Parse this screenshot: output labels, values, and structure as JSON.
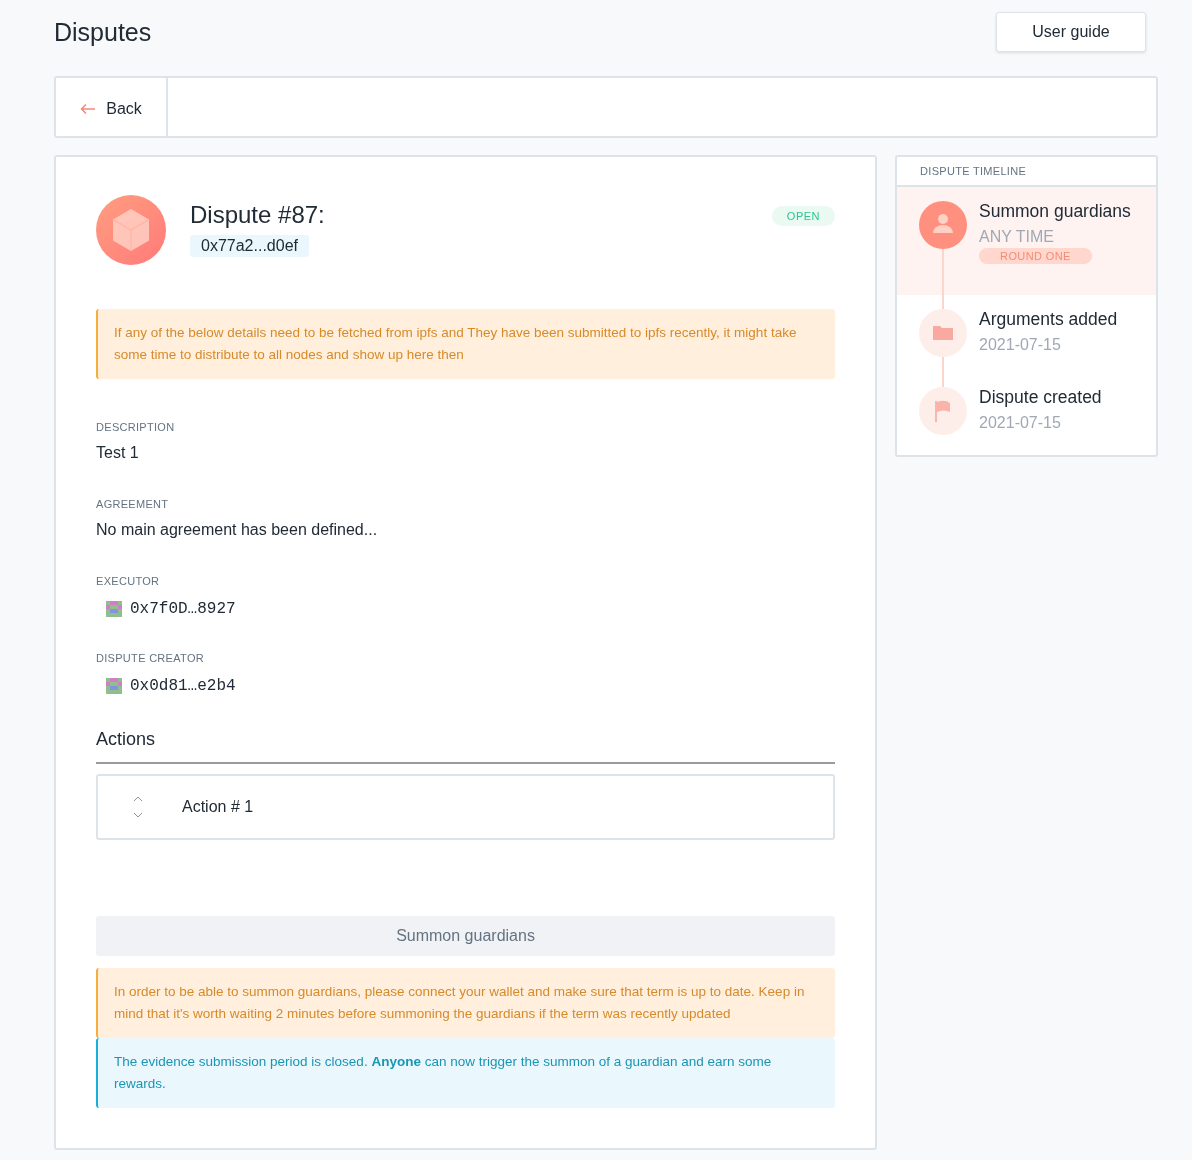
{
  "page_title": "Disputes",
  "user_guide_button": "User guide",
  "back_button": "Back",
  "dispute": {
    "title": "Dispute #87:",
    "address": "0x77a2...d0ef",
    "status": "OPEN"
  },
  "ipfs_notice": "If any of the below details need to be fetched from ipfs and They have been submitted to ipfs recently, it might take some time to distribute to all nodes and show up here then",
  "details": [
    {
      "label": "DESCRIPTION",
      "kind": "text",
      "value": "Test 1"
    },
    {
      "label": "AGREEMENT",
      "kind": "text",
      "value": "No main agreement has been defined..."
    },
    {
      "label": "EXECUTOR",
      "kind": "address",
      "value": "0x7f0D…8927"
    },
    {
      "label": "DISPUTE CREATOR",
      "kind": "address",
      "value": "0x0d81…e2b4"
    }
  ],
  "actions": {
    "title": "Actions",
    "items": [
      {
        "label": "Action # 1",
        "expanded": false
      }
    ]
  },
  "summon_button": {
    "label": "Summon guardians",
    "disabled": true
  },
  "wallet_notice": "In order to be able to summon guardians, please connect your wallet and make sure that term is up to date. Keep in mind that it's worth waiting 2 minutes before summoning the guardians if the term was recently updated",
  "evidence_notice": "The evidence submission period is closed. **Anyone** can now trigger the summon of a guardian and earn some rewards.",
  "timeline": {
    "title": "DISPUTE TIMELINE",
    "items": [
      {
        "kind": "person",
        "title": "Summon guardians",
        "subtitle": "ANY TIME",
        "badge": "ROUND ONE",
        "selected": true
      },
      {
        "kind": "folder",
        "title": "Arguments added",
        "subtitle": "2021-07-15",
        "selected": false
      },
      {
        "kind": "flag",
        "title": "Dispute created",
        "subtitle": "2021-07-15",
        "selected": false
      }
    ]
  }
}
